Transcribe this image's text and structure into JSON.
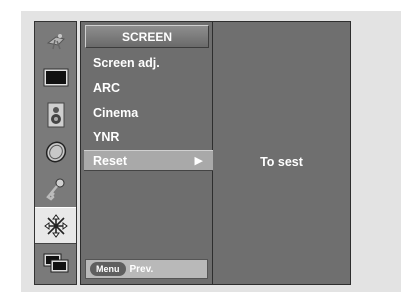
{
  "icons": [
    {
      "name": "antenna-icon"
    },
    {
      "name": "screen-icon"
    },
    {
      "name": "speaker-icon"
    },
    {
      "name": "clock-icon"
    },
    {
      "name": "key-icon"
    },
    {
      "name": "arrows-icon",
      "selected": true
    },
    {
      "name": "pip-icon"
    }
  ],
  "menu": {
    "title": "SCREEN",
    "items": [
      {
        "label": "Screen adj."
      },
      {
        "label": "ARC"
      },
      {
        "label": "Cinema"
      },
      {
        "label": "YNR"
      },
      {
        "label": "Reset",
        "selected": true
      }
    ],
    "footer": {
      "button": "Menu",
      "label": "Prev."
    }
  },
  "submenu": {
    "text": "To sest"
  },
  "colors": {
    "panel": "#6e6e6e",
    "selected": "#a9a9a9",
    "icon_column": "#7a7a7a"
  }
}
